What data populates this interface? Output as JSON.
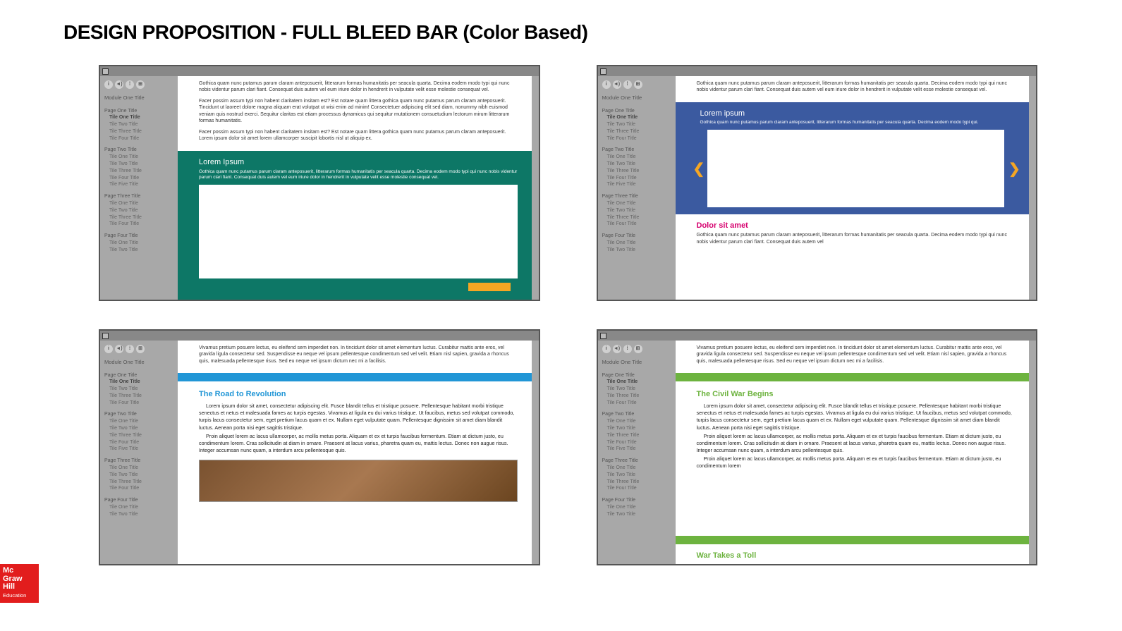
{
  "title": "DESIGN PROPOSITION - FULL BLEED BAR (Color Based)",
  "logo": [
    "Mc",
    "Graw",
    "Hill",
    "Education"
  ],
  "sidebar": {
    "module": "Module One Title",
    "groups": [
      {
        "page": "Page One Title",
        "items": [
          "Tile One Title",
          "Tile Two Title",
          "Tile Three Title",
          "Tile Four Title"
        ],
        "active": 0
      },
      {
        "page": "Page Two Title",
        "items": [
          "Tile One Title",
          "Tile Two Title",
          "Tile Three Title",
          "Tile Four Title",
          "Tile Five Title"
        ]
      },
      {
        "page": "Page Three Title",
        "items": [
          "Tile One Title",
          "Tile Two Title",
          "Tile Three Title",
          "Tile Four Title"
        ]
      },
      {
        "page": "Page Four Title",
        "items": [
          "Tile One Title",
          "Tile Two Title"
        ]
      }
    ]
  },
  "lorem": {
    "p1": "Gothica quam nunc putamus parum claram anteposuerit, litterarum formas humanitatis per seacula quarta. Decima eodem modo typi qui nunc nobis videntur parum clari fiant. Consequat duis autem vel eum iriure dolor in hendrerit in vulputate velit esse molestie consequat vel.",
    "p2": "Facer possim assum typi non habent claritatem insitam est? Est notare quam littera gothica quam nunc putamus parum claram anteposuerit. Tincidunt ut laoreet dolore magna aliquam erat volutpat ut wisi enim ad minim! Consectetuer adipiscing elit sed diam, nonummy nibh euismod veniam quis nostrud exerci. Sequitur claritas est etiam processus dynamicus qui sequitur mutationem consuetudium lectorum mirum litterarum formas humanitatis.",
    "p3": "Facer possim assum typi non habent claritatem insitam est? Est notare quam littera gothica quam nunc putamus parum claram anteposuerit. Lorem ipsum dolor sit amet lorem ullamcorper suscipit lobortis nisl ut aliquip ex."
  },
  "mock1": {
    "heading": "Lorem Ipsum",
    "sub": "Gothica quam nunc putamus parum claram anteposuerit, litterarum formas humanitatis per seacula quarta. Decima eodem modo typi qui nunc nobis videntur parum clari fiant. Consequat duis autem vel eum iriure dolor in hendrerit in vulputate velit esse molestie consequat vel."
  },
  "mock2": {
    "heading": "Lorem ipsum",
    "sub": "Gothica quam nunc putamus parum claram anteposuerit, litterarum formas humanitatis per seacula quarta. Decima eodem modo typi qui.",
    "dolor_h": "Dolor sit amet",
    "dolor_p": "Gothica quam nunc putamus parum claram anteposuerit, litterarum formas humanitatis per seacula quarta. Decima eodem modo typi qui nunc nobis videntur parum clari fiant. Consequat duis autem vel"
  },
  "intro34": "Vivamus pretium posuere lectus, eu eleifend sem imperdiet non. In tincidunt dolor sit amet elementum luctus. Curabitur mattis ante eros, vel gravida ligula consectetur sed. Suspendisse eu neque vel ipsum pellentesque condimentum sed vel velit. Etiam nisl sapien, gravida a rhoncus quis, malesuada pellentesque risus. Sed eu neque vel ipsum dictum nec mi a facilisis.",
  "mock3": {
    "heading": "The Road to Revolution",
    "body1": "Lorem ipsum dolor sit amet, consectetur adipiscing elit. Fusce blandit tellus et tristique posuere. Pellentesque habitant morbi tristique senectus et netus et malesuada fames ac turpis egestas. Vivamus at ligula eu dui varius tristique. Ut faucibus, metus sed volutpat commodo, turpis lacus consectetur sem, eget pretium lacus quam et ex. Nullam eget vulputate quam. Pellentesque dignissim sit amet diam blandit luctus. Aenean porta nisi eget sagittis tristique.",
    "body2": "Proin aliquet lorem ac lacus ullamcorper, ac mollis metus porta. Aliquam et ex et turpis faucibus fermentum. Etiam at dictum justo, eu condimentum lorem. Cras sollicitudin at diam in ornare. Praesent at lacus varius, pharetra quam eu, mattis lectus. Donec non augue risus. Integer accumsan nunc quam, a interdum arcu pellentesque quis."
  },
  "mock4": {
    "heading": "The Civil War Begins",
    "body1": "Lorem ipsum dolor sit amet, consectetur adipiscing elit. Fusce blandit tellus et tristique posuere. Pellentesque habitant morbi tristique senectus et netus et malesuada fames ac turpis egestas. Vivamus at ligula eu dui varius tristique. Ut faucibus, metus sed volutpat commodo, turpis lacus consectetur sem, eget pretium lacus quam et ex. Nullam eget vulputate quam. Pellentesque dignissim sit amet diam blandit luctus. Aenean porta nisi eget sagittis tristique.",
    "body2": "Proin aliquet lorem ac lacus ullamcorper, ac mollis metus porta. Aliquam et ex et turpis faucibus fermentum. Etiam at dictum justo, eu condimentum lorem. Cras sollicitudin at diam in ornare. Praesent at lacus varius, pharetra quam eu, mattis lectus. Donec non augue risus. Integer accumsan nunc quam, a interdum arcu pellentesque quis.",
    "body3": "Proin aliquet lorem ac lacus ullamcorper, ac mollis metus porta. Aliquam et ex et turpis faucibus fermentum. Etiam at dictum justo, eu condimentum lorem",
    "heading2": "War Takes a Toll"
  }
}
